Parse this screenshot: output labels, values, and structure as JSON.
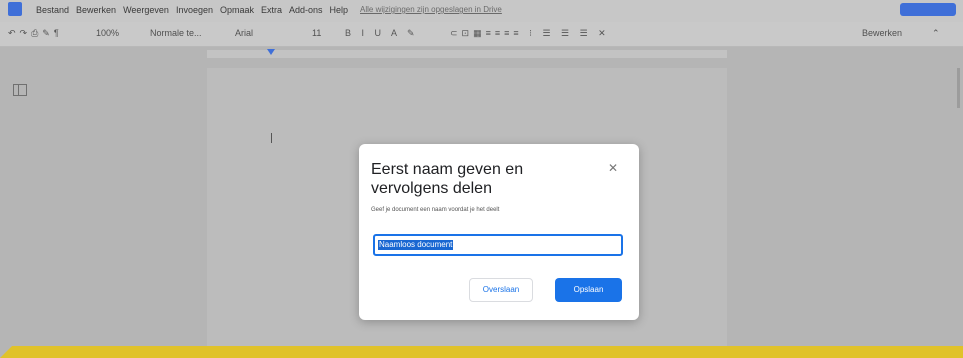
{
  "menubar": {
    "items": [
      "Bestand",
      "Bewerken",
      "Weergeven",
      "Invoegen",
      "Opmaak",
      "Extra",
      "Add-ons",
      "Help"
    ],
    "saved_text": "Alle wijzigingen zijn opgeslagen in Drive"
  },
  "toolbar": {
    "zoom": "100%",
    "style": "Normale te...",
    "font": "Arial",
    "font_size": "11",
    "editing_mode": "Bewerken"
  },
  "dialog": {
    "title": "Eerst naam geven en vervolgens delen",
    "subtitle": "Geef je document een naam voordat je het deelt",
    "input_value": "Naamloos document",
    "skip_label": "Overslaan",
    "save_label": "Opslaan"
  },
  "colors": {
    "accent": "#1a73e8",
    "band": "#e0c22a"
  }
}
